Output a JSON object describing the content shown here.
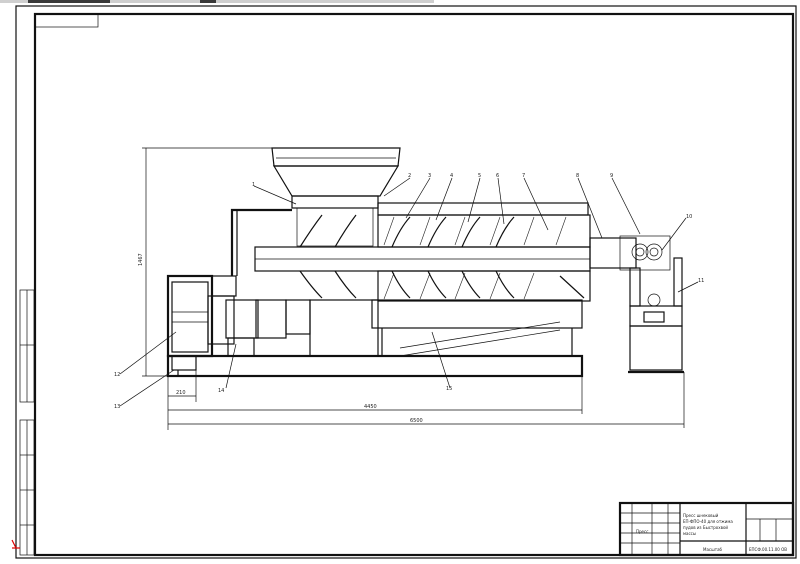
{
  "frame": {
    "corner_mark": ""
  },
  "dimensions": {
    "height": "1467",
    "base_width": "210",
    "length_inner": "4450",
    "length_total": "6500"
  },
  "callouts": [
    "1",
    "2",
    "3",
    "4",
    "5",
    "6",
    "7",
    "8",
    "9",
    "10",
    "11",
    "12",
    "13",
    "14",
    "15"
  ],
  "title_block": {
    "name_lines": [
      "Пресс шнековый",
      "ЕП-ФПО-40 для отжима",
      "пудов из Быстрохвой",
      "массы"
    ],
    "scale_note": "Масштаб",
    "code": "ЕПСФ.00.11.00 ОВ",
    "stamp_label": "Пресс"
  },
  "colors": {
    "line": "#111111",
    "paper": "#ffffff",
    "toolbar": "#3a3a3a"
  }
}
